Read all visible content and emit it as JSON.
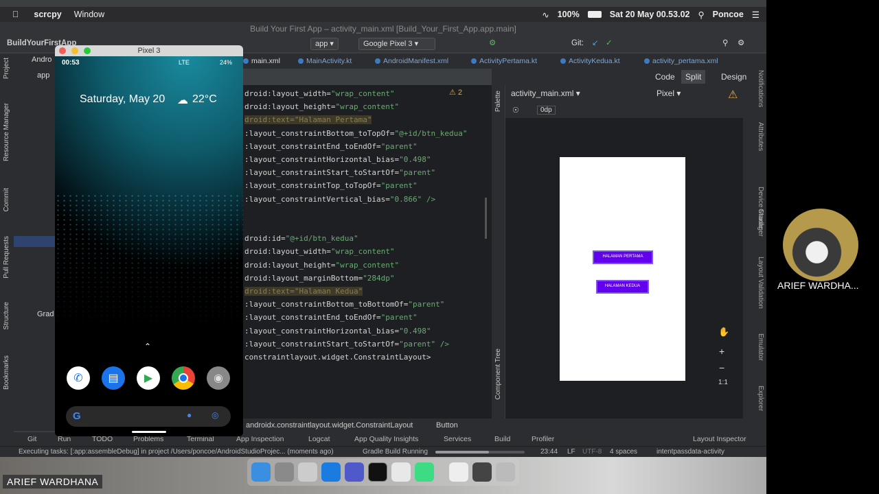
{
  "menubar": {
    "app": "scrcpy",
    "menu": "Window",
    "battery": "100%",
    "datetime": "Sat 20 May  00.53.02",
    "user": "Poncoe"
  },
  "ide": {
    "window_title": "Build Your First App – activity_main.xml [Build_Your_First_App.app.main]",
    "project": "BuildYourFirstApp",
    "run_config": "app",
    "device": "Google Pixel 3",
    "git_label": "Git:",
    "tabs": [
      "main.xml",
      "MainActivity.kt",
      "AndroidManifest.xml",
      "ActivityPertama.kt",
      "ActivityKedua.kt",
      "activity_pertama.xml"
    ],
    "view_modes": [
      "Code",
      "Split",
      "Design"
    ],
    "warn_count": "2",
    "design_file": "activity_main.xml",
    "design_device": "Pixel",
    "dp_value": "0dp",
    "code_lines": [
      {
        "a": "droid:layout_width=",
        "v": "\"wrap_content\""
      },
      {
        "a": "droid:layout_height=",
        "v": "\"wrap_content\""
      },
      {
        "a": "droid:text=",
        "v": "\"Halaman Pertama\"",
        "hl": true
      },
      {
        "a": ":layout_constraintBottom_toTopOf=",
        "v": "\"@+id/btn_kedua\""
      },
      {
        "a": ":layout_constraintEnd_toEndOf=",
        "v": "\"parent\""
      },
      {
        "a": ":layout_constraintHorizontal_bias=",
        "v": "\"0.498\""
      },
      {
        "a": ":layout_constraintStart_toStartOf=",
        "v": "\"parent\""
      },
      {
        "a": ":layout_constraintTop_toTopOf=",
        "v": "\"parent\""
      },
      {
        "a": ":layout_constraintVertical_bias=",
        "v": "\"0.866\" />"
      },
      {
        "a": "",
        "v": ""
      },
      {
        "a": "",
        "v": ""
      },
      {
        "a": "droid:id=",
        "v": "\"@+id/btn_kedua\""
      },
      {
        "a": "droid:layout_width=",
        "v": "\"wrap_content\""
      },
      {
        "a": "droid:layout_height=",
        "v": "\"wrap_content\""
      },
      {
        "a": "droid:layout_marginBottom=",
        "v": "\"284dp\""
      },
      {
        "a": "droid:text=",
        "v": "\"Halaman Kedua\"",
        "hl": true
      },
      {
        "a": ":layout_constraintBottom_toBottomOf=",
        "v": "\"parent\""
      },
      {
        "a": ":layout_constraintEnd_toEndOf=",
        "v": "\"parent\""
      },
      {
        "a": ":layout_constraintHorizontal_bias=",
        "v": "\"0.498\""
      },
      {
        "a": ":layout_constraintStart_toStartOf=",
        "v": "\"parent\" />"
      },
      {
        "a": "constraintlayout.widget.ConstraintLayout>",
        "v": ""
      }
    ],
    "preview_buttons": [
      "HALAMAN PERTAMA",
      "HALAMAN KEDUA"
    ],
    "breadcrumb": [
      "androidx.constraintlayout.widget.ConstraintLayout",
      "Button"
    ],
    "bottom_tabs": [
      "Git",
      "Run",
      "TODO",
      "Problems",
      "Terminal",
      "App Inspection",
      "Logcat",
      "App Quality Insights",
      "Services",
      "Build",
      "Profiler",
      "Layout Inspector"
    ],
    "status_text": "Executing tasks: [:app:assembleDebug] in project /Users/poncoe/AndroidStudioProjec... (moments ago)",
    "gradle": "Gradle Build Running",
    "cursor_pos": "23:44",
    "line_sep": "LF",
    "encoding": "UTF-8",
    "indent": "4 spaces",
    "branch": "intentpassdata-activity",
    "left_panels": [
      "Project",
      "Resource Manager",
      "Commit",
      "Pull Requests",
      "Structure",
      "Bookmarks"
    ],
    "right_panels": [
      "Notifications",
      "Attributes",
      "Device Manager",
      "Gradle",
      "Layout Validation",
      "Emulator",
      "Device File Explorer"
    ],
    "palette": "Palette",
    "component_tree": "Component Tree",
    "zoom_ratio": "1:1",
    "project_tree_label": "Andro",
    "project_tree_items": [
      "app",
      "Grad"
    ]
  },
  "emulator": {
    "title": "Pixel 3",
    "time": "00:53",
    "network": "LTE",
    "battery": "24%",
    "date_weather": "Saturday, May 20",
    "temp": "22°C"
  },
  "participant": {
    "name": "ARIEF WARDHA...",
    "badge": "ARIEF WARDHANA"
  }
}
